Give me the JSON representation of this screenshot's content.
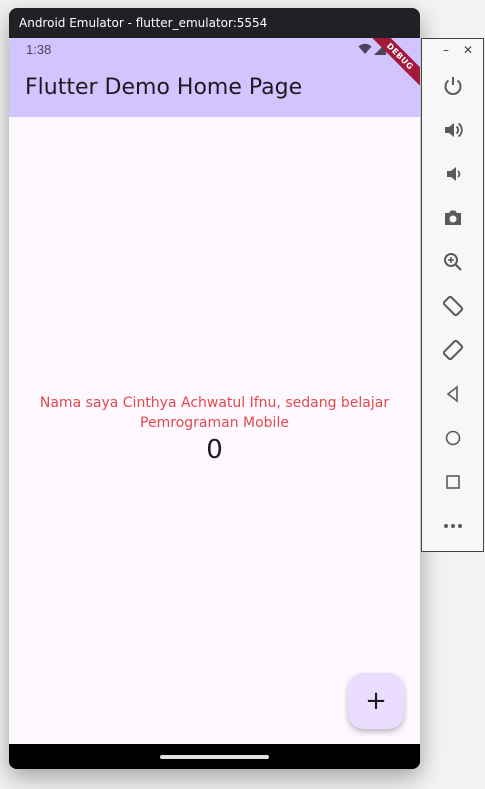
{
  "window": {
    "title": "Android Emulator - flutter_emulator:5554"
  },
  "status_bar": {
    "time": "1:38",
    "icons": [
      "wifi-icon",
      "signal-icon",
      "battery-icon"
    ]
  },
  "app_bar": {
    "title": "Flutter Demo Home Page",
    "debug_banner": "DEBUG"
  },
  "content": {
    "message": "Nama saya Cinthya Achwatul Ifnu, sedang belajar Pemrograman Mobile",
    "counter": "0"
  },
  "fab": {
    "label": "+"
  },
  "side_toolbar": {
    "controls": [
      "minimize-icon",
      "close-icon"
    ],
    "tools": [
      "power-icon",
      "volume-up-icon",
      "volume-down-icon",
      "camera-icon",
      "zoom-icon",
      "rotate-left-icon",
      "rotate-right-icon",
      "back-icon",
      "home-icon",
      "overview-icon",
      "more-icon"
    ]
  },
  "colors": {
    "app_bar": "#d1c4ff",
    "screen_bg": "#fdf7ff",
    "message_text": "#e14b4b",
    "fab_bg": "#eaddff",
    "debug_banner": "#a3193a"
  }
}
